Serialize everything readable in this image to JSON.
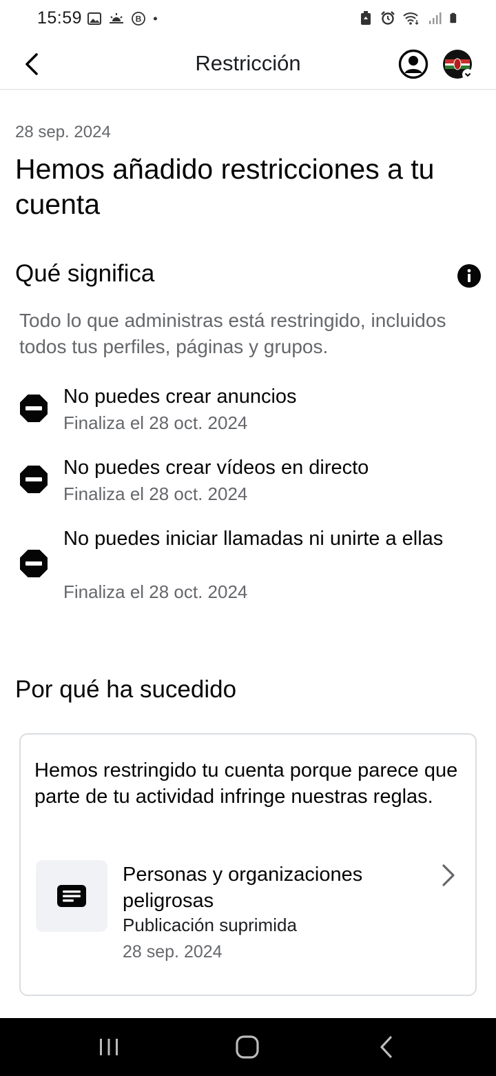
{
  "status_bar": {
    "time": "15:59",
    "left_icons": [
      "gallery-icon",
      "weather-icon",
      "b-icon",
      "dot-icon"
    ],
    "right_icons": [
      "battery-saver-icon",
      "alarm-icon",
      "wifi-icon",
      "signal-icon",
      "battery-icon"
    ]
  },
  "app_bar": {
    "back_icon": "back-arrow-icon",
    "title": "Restricción",
    "profile_icon": "profile-icon",
    "avatar": "account-avatar"
  },
  "date": "28 sep. 2024",
  "headline": "Hemos añadido restricciones a tu cuenta",
  "what_it_means": {
    "title": "Qué significa",
    "info_icon": "info-icon",
    "description": "Todo lo que administras está restringido, incluidos todos tus perfiles, páginas y grupos.",
    "restrictions": [
      {
        "title": "No puedes crear anuncios",
        "ends": "Finaliza el 28 oct. 2024",
        "icon": "no-entry-icon"
      },
      {
        "title": "No puedes crear vídeos en directo",
        "ends": "Finaliza el 28 oct. 2024",
        "icon": "no-entry-icon"
      },
      {
        "title": "No puedes iniciar llamadas ni unirte a ellas",
        "ends": "Finaliza el 28 oct. 2024",
        "icon": "no-entry-icon"
      }
    ]
  },
  "why": {
    "title": "Por qué ha sucedido",
    "text": "Hemos restringido tu cuenta porque parece que parte de tu actividad infringe nuestras reglas.",
    "item": {
      "title": "Personas y organizaciones peligrosas",
      "subtitle": "Publicación suprimida",
      "date": "28 sep. 2024",
      "icon": "post-icon"
    }
  },
  "nav_bar": {
    "recents_icon": "recents-icon",
    "home_icon": "home-icon",
    "back_icon": "nav-back-icon"
  },
  "colors": {
    "text_primary": "#050505",
    "text_secondary": "#65676b",
    "border": "#dadde1",
    "thumb_bg": "#f0f2f5",
    "nav_bg": "#000000"
  }
}
